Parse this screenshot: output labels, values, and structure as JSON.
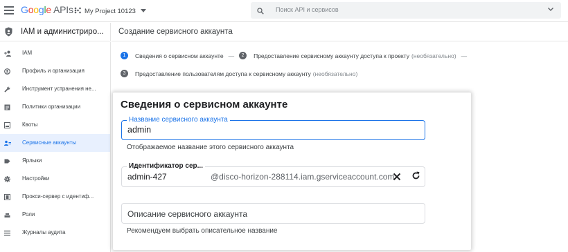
{
  "topbar": {
    "logo_google": [
      "G",
      "o",
      "o",
      "g",
      "l",
      "e"
    ],
    "logo_apis": "APIs",
    "project_name": "My Project 10123",
    "search_placeholder": "Поиск API и сервисов"
  },
  "sidebar": {
    "section_title": "IAM и администриро...",
    "items": [
      {
        "label": "IAM",
        "icon": "person-add-icon",
        "active": false
      },
      {
        "label": "Профиль и организация",
        "icon": "account-circle-icon",
        "active": false
      },
      {
        "label": "Инструмент устранения не...",
        "icon": "wrench-icon",
        "active": false
      },
      {
        "label": "Политики организации",
        "icon": "policy-list-icon",
        "active": false
      },
      {
        "label": "Квоты",
        "icon": "quota-icon",
        "active": false
      },
      {
        "label": "Сервисные аккаунты",
        "icon": "service-account-icon",
        "active": true
      },
      {
        "label": "Ярлыки",
        "icon": "label-tag-icon",
        "active": false
      },
      {
        "label": "Настройки",
        "icon": "gear-icon",
        "active": false
      },
      {
        "label": "Прокси-сервер с идентиф...",
        "icon": "proxy-icon",
        "active": false
      },
      {
        "label": "Роли",
        "icon": "roles-icon",
        "active": false
      },
      {
        "label": "Журналы аудита",
        "icon": "audit-list-icon",
        "active": false
      }
    ]
  },
  "page": {
    "title": "Создание сервисного аккаунта"
  },
  "stepper": {
    "step1": {
      "num": "1",
      "label": "Сведения о сервисном аккаунте"
    },
    "step2": {
      "num": "2",
      "label": "Предоставление сервисному аккаунту доступа к проекту",
      "optional": "(необязательно)"
    },
    "step3": {
      "num": "3",
      "label": "Предоставление пользователям доступа к сервисному аккаунту",
      "optional": "(необязательно)"
    },
    "separator": "—"
  },
  "card": {
    "title": "Сведения о сервисном аккаунте",
    "name_field": {
      "label": "Название сервисного аккаунта",
      "value": "admin",
      "hint": "Отображаемое название этого сервисного аккаунта"
    },
    "id_field": {
      "label": "Идентификатор сер...",
      "value": "admin-427",
      "suffix": "@disco-horizon-288114.iam.gserviceaccount.com"
    },
    "desc_field": {
      "placeholder": "Описание сервисного аккаунта",
      "hint": "Рекомендуем выбрать описательное название"
    }
  },
  "colors": {
    "accent": "#1a73e8",
    "active_bg": "#e8f0fe",
    "step_inactive": "#5f6368"
  }
}
